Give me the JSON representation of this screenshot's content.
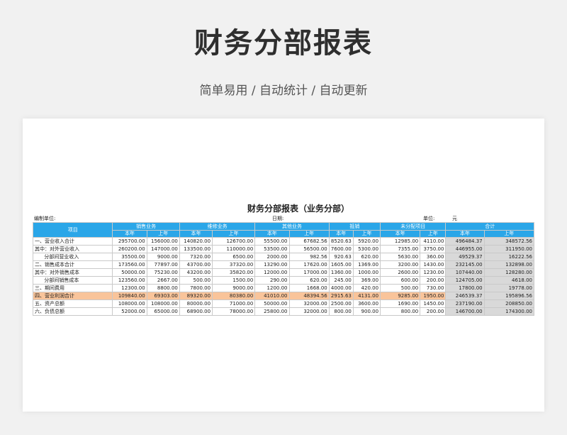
{
  "page": {
    "title": "财务分部报表",
    "subtitle": "简单易用 / 自动统计 / 自动更新"
  },
  "report": {
    "title": "财务分部报表（业务分部）",
    "unit_label": "编制单位:",
    "date_label": "日期:",
    "money_label": "单位:",
    "money_unit": "元",
    "item_header": "项目",
    "groups": [
      "销售业务",
      "维修业务",
      "其他业务",
      "抵销",
      "未分配项目",
      "合计"
    ],
    "sub_headers": [
      "本年",
      "上年"
    ],
    "highlight_row": 6,
    "rows": [
      {
        "label": "一、营业收入合计",
        "values": [
          "295700.00",
          "156000.00",
          "140820.00",
          "126700.00",
          "55500.00",
          "67682.56",
          "8520.63",
          "5920.00",
          "12985.00",
          "4110.00",
          "496484.37",
          "348572.56"
        ]
      },
      {
        "label": "其中：对外营业收入",
        "values": [
          "260200.00",
          "147000.00",
          "133500.00",
          "110000.00",
          "53500.00",
          "56500.00",
          "7600.00",
          "5300.00",
          "7355.00",
          "3750.00",
          "446955.00",
          "311950.00"
        ]
      },
      {
        "label": "      分部间营业收入",
        "values": [
          "35500.00",
          "9000.00",
          "7320.00",
          "6500.00",
          "2000.00",
          "982.56",
          "920.63",
          "620.00",
          "5630.00",
          "360.00",
          "49529.37",
          "16222.56"
        ]
      },
      {
        "label": "二、销售成本合计",
        "values": [
          "173560.00",
          "77897.00",
          "43700.00",
          "37320.00",
          "13290.00",
          "17620.00",
          "1605.00",
          "1369.00",
          "3200.00",
          "1430.00",
          "232145.00",
          "132898.00"
        ]
      },
      {
        "label": "其中：对外销售成本",
        "values": [
          "50000.00",
          "75230.00",
          "43200.00",
          "35820.00",
          "12000.00",
          "17000.00",
          "1360.00",
          "1000.00",
          "2600.00",
          "1230.00",
          "107440.00",
          "128280.00"
        ]
      },
      {
        "label": "      分部间销售成本",
        "values": [
          "123560.00",
          "2667.00",
          "500.00",
          "1500.00",
          "290.00",
          "620.00",
          "245.00",
          "369.00",
          "600.00",
          "200.00",
          "124705.00",
          "4618.00"
        ]
      },
      {
        "label": "三、期间费用",
        "values": [
          "12300.00",
          "8800.00",
          "7800.00",
          "9000.00",
          "1200.00",
          "1668.00",
          "4000.00",
          "420.00",
          "500.00",
          "730.00",
          "17800.00",
          "19778.00"
        ]
      },
      {
        "label": "四、营业利润合计",
        "values": [
          "109840.00",
          "69303.00",
          "89320.00",
          "80380.00",
          "41010.00",
          "48394.56",
          "2915.63",
          "4131.00",
          "9285.00",
          "1950.00",
          "246539.37",
          "195896.56"
        ]
      },
      {
        "label": "五、资产总额",
        "values": [
          "108000.00",
          "108000.00",
          "80000.00",
          "71000.00",
          "50000.00",
          "32000.00",
          "2500.00",
          "3600.00",
          "1690.00",
          "1450.00",
          "237190.00",
          "208850.00"
        ]
      },
      {
        "label": "六、负债总额",
        "values": [
          "52000.00",
          "65000.00",
          "68900.00",
          "78000.00",
          "25800.00",
          "32000.00",
          "800.00",
          "900.00",
          "800.00",
          "200.00",
          "146700.00",
          "174300.00"
        ]
      }
    ]
  }
}
